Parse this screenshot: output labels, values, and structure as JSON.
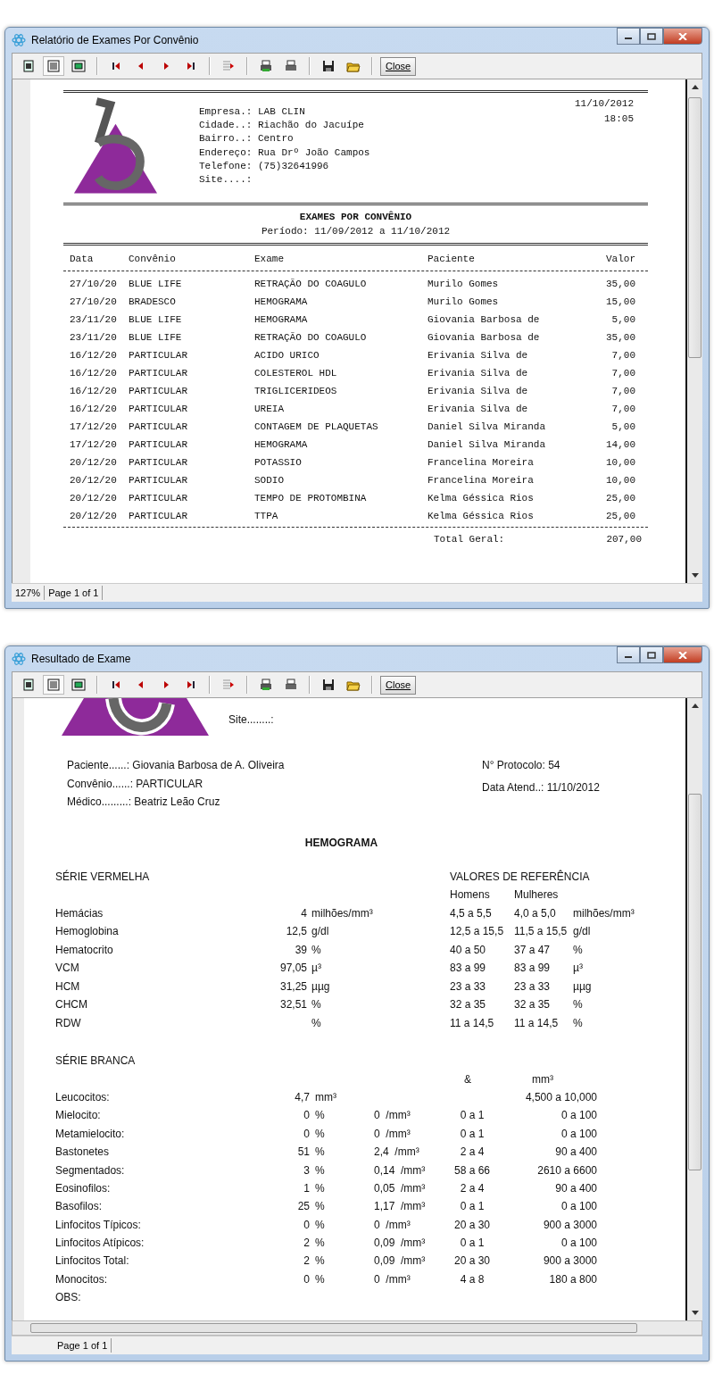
{
  "windows": [
    {
      "kind": "convenio_report",
      "title": "Relatório de Exames Por Convênio",
      "close_label": "Close",
      "zoom": "127%",
      "page": "Page 1 of 1",
      "report": {
        "company": [
          {
            "label": "Empresa.:",
            "value": "LAB CLIN"
          },
          {
            "label": "Cidade..:",
            "value": "Riachão do Jacuípe"
          },
          {
            "label": "Bairro..:",
            "value": "Centro"
          },
          {
            "label": "Endereço:",
            "value": "Rua Drº João Campos"
          },
          {
            "label": "Telefone:",
            "value": "(75)32641996"
          },
          {
            "label": "Site....:"
          }
        ],
        "date": "11/10/2012",
        "time": "18:05",
        "title": "EXAMES POR CONVÊNIO",
        "period": "Período: 11/09/2012 a 11/10/2012",
        "columns": [
          "Data",
          "Convênio",
          "Exame",
          "Paciente",
          "Valor"
        ],
        "rows": [
          [
            "27/10/20",
            "BLUE LIFE",
            "RETRAÇÃO DO COAGULO",
            "Murilo Gomes",
            "35,00"
          ],
          [
            "27/10/20",
            "BRADESCO",
            "HEMOGRAMA",
            "Murilo Gomes",
            "15,00"
          ],
          [
            "23/11/20",
            "BLUE LIFE",
            "HEMOGRAMA",
            "Giovania Barbosa de",
            "5,00"
          ],
          [
            "23/11/20",
            "BLUE LIFE",
            "RETRAÇÃO DO COAGULO",
            "Giovania Barbosa de",
            "35,00"
          ],
          [
            "16/12/20",
            "PARTICULAR",
            "ACIDO URICO",
            "Erivania Silva de",
            "7,00"
          ],
          [
            "16/12/20",
            "PARTICULAR",
            "COLESTEROL HDL",
            "Erivania Silva de",
            "7,00"
          ],
          [
            "16/12/20",
            "PARTICULAR",
            "TRIGLICERIDEOS",
            "Erivania Silva de",
            "7,00"
          ],
          [
            "16/12/20",
            "PARTICULAR",
            "UREIA",
            "Erivania Silva de",
            "7,00"
          ],
          [
            "17/12/20",
            "PARTICULAR",
            "CONTAGEM DE PLAQUETAS",
            "Daniel Silva Miranda",
            "5,00"
          ],
          [
            "17/12/20",
            "PARTICULAR",
            "HEMOGRAMA",
            "Daniel Silva Miranda",
            "14,00"
          ],
          [
            "20/12/20",
            "PARTICULAR",
            "POTASSIO",
            "Francelina Moreira",
            "10,00"
          ],
          [
            "20/12/20",
            "PARTICULAR",
            "SODIO",
            "Francelina Moreira",
            "10,00"
          ],
          [
            "20/12/20",
            "PARTICULAR",
            "TEMPO DE PROTOMBINA",
            "Kelma Géssica Rios",
            "25,00"
          ],
          [
            "20/12/20",
            "PARTICULAR",
            "TTPA",
            "Kelma Géssica Rios",
            "25,00"
          ]
        ],
        "total_label": "Total Geral:",
        "total": "207,00"
      }
    },
    {
      "kind": "exam_result",
      "title": "Resultado de Exame",
      "close_label": "Close",
      "page": "Page 1 of 1",
      "report": {
        "site_label": "Site........:",
        "patient": [
          {
            "label": "Paciente......:",
            "value": "Giovania Barbosa de A. Oliveira"
          },
          {
            "label": "Convênio......:",
            "value": "PARTICULAR"
          },
          {
            "label": "Médico.........:",
            "value": "Beatriz Leão Cruz"
          }
        ],
        "protocol": [
          {
            "label": "N° Protocolo:",
            "value": "54"
          },
          {
            "label": "Data Atend..:",
            "value": "11/10/2012"
          }
        ],
        "title": "HEMOGRAMA",
        "red": {
          "heading": "SÉRIE VERMELHA",
          "ref_heading": "VALORES DE REFERÊNCIA",
          "men": "Homens",
          "women": "Mulheres",
          "rows": [
            {
              "name": "Hemácias",
              "value": "4",
              "unit": "milhões/mm³",
              "men": "4,5 a 5,5",
              "women": "4,0 a 5,0",
              "ref_unit": "milhões/mm³"
            },
            {
              "name": "Hemoglobina",
              "value": "12,5",
              "unit": "g/dl",
              "men": "12,5 a 15,5",
              "women": "11,5 a 15,5",
              "ref_unit": "g/dl"
            },
            {
              "name": "Hematocrito",
              "value": "39",
              "unit": "%",
              "men": "40 a 50",
              "women": "37 a 47",
              "ref_unit": "%"
            },
            {
              "name": "VCM",
              "value": "97,05",
              "unit": "µ³",
              "men": "83 a 99",
              "women": "83 a 99",
              "ref_unit": "µ³"
            },
            {
              "name": "HCM",
              "value": "31,25",
              "unit": "µµg",
              "men": "23 a 33",
              "women": "23 a 33",
              "ref_unit": "µµg"
            },
            {
              "name": "CHCM",
              "value": "32,51",
              "unit": "%",
              "men": "32 a 35",
              "women": "32 a 35",
              "ref_unit": "%"
            },
            {
              "name": "RDW",
              "unit": "%",
              "men": "11 a 14,5",
              "women": "11 a 14,5",
              "ref_unit": "%"
            }
          ]
        },
        "white": {
          "heading": "SÉRIE BRANCA",
          "rel_heading": "&",
          "abs_heading": "mm³",
          "rows": [
            {
              "name": "Leucocitos:",
              "value": "4,7",
              "unit": "mm³",
              "ref_abs": "4,500 a 10,000"
            },
            {
              "name": "Mielocito:",
              "value": "0",
              "unit": "%",
              "abs": "0",
              "abs_unit": "/mm³",
              "ref_rel": "0 a 1",
              "ref_abs": "0 a 100"
            },
            {
              "name": "Metamielocito:",
              "value": "0",
              "unit": "%",
              "abs": "0",
              "abs_unit": "/mm³",
              "ref_rel": "0 a 1",
              "ref_abs": "0 a 100"
            },
            {
              "name": "Bastonetes",
              "value": "51",
              "unit": "%",
              "abs": "2,4",
              "abs_unit": "/mm³",
              "ref_rel": "2 a 4",
              "ref_abs": "90 a 400"
            },
            {
              "name": "Segmentados:",
              "value": "3",
              "unit": "%",
              "abs": "0,14",
              "abs_unit": "/mm³",
              "ref_rel": "58 a 66",
              "ref_abs": "2610 a 6600"
            },
            {
              "name": "Eosinofilos:",
              "value": "1",
              "unit": "%",
              "abs": "0,05",
              "abs_unit": "/mm³",
              "ref_rel": "2 a 4",
              "ref_abs": "90 a 400"
            },
            {
              "name": "Basofilos:",
              "value": "25",
              "unit": "%",
              "abs": "1,17",
              "abs_unit": "/mm³",
              "ref_rel": "0 a 1",
              "ref_abs": "0 a 100"
            },
            {
              "name": "Linfocitos Típicos:",
              "value": "0",
              "unit": "%",
              "abs": "0",
              "abs_unit": "/mm³",
              "ref_rel": "20 a 30",
              "ref_abs": "900 a 3000"
            },
            {
              "name": "Linfocitos Atípicos:",
              "value": "2",
              "unit": "%",
              "abs": "0,09",
              "abs_unit": "/mm³",
              "ref_rel": "0 a 1",
              "ref_abs": "0 a 100"
            },
            {
              "name": "Linfocitos Total:",
              "value": "2",
              "unit": "%",
              "abs": "0,09",
              "abs_unit": "/mm³",
              "ref_rel": "20 a 30",
              "ref_abs": "900 a 3000"
            },
            {
              "name": "Monocitos:",
              "value": "0",
              "unit": "%",
              "abs": "0",
              "abs_unit": "/mm³",
              "ref_rel": "4 a 8",
              "ref_abs": "180 a 800"
            }
          ],
          "obs_label": "OBS:"
        }
      }
    }
  ]
}
